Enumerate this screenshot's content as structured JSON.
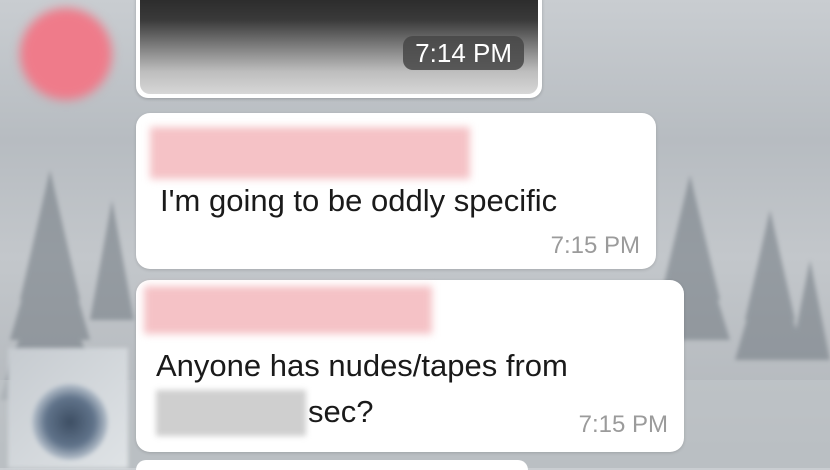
{
  "colors": {
    "bubble": "#ffffff",
    "timestamp": "#9b9b9b",
    "text": "#1a1a1a",
    "redaction_pink": "#f5c2c6",
    "avatar_pink": "#ef7b8a"
  },
  "messages": [
    {
      "type": "media",
      "time": "7:14 PM"
    },
    {
      "type": "text",
      "text": "I'm going to be oddly specific",
      "time": "7:15 PM"
    },
    {
      "type": "text",
      "line1": "Anyone has nudes/tapes from",
      "line2_suffix": "sec?",
      "time": "7:15 PM"
    }
  ]
}
